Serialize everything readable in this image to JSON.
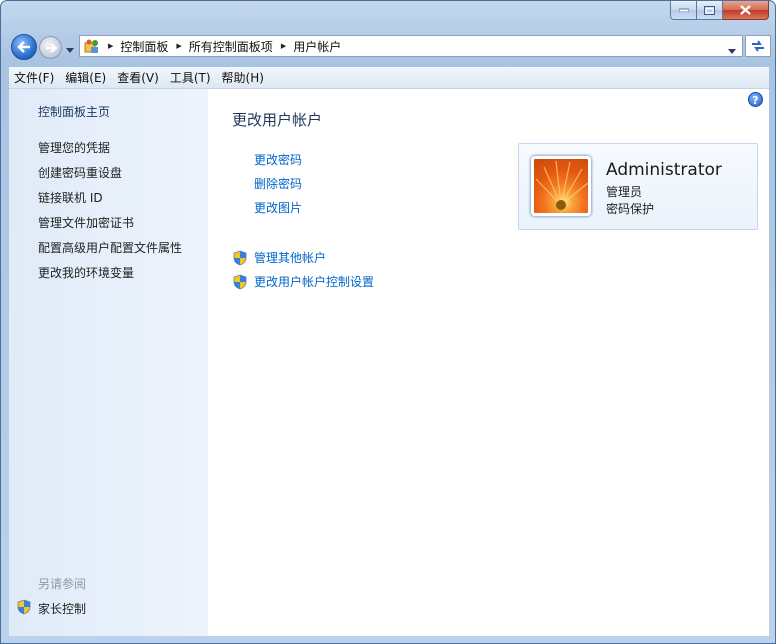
{
  "address_bar": {
    "crumbs": [
      "控制面板",
      "所有控制面板项",
      "用户帐户"
    ]
  },
  "menu": {
    "items": [
      "文件(F)",
      "编辑(E)",
      "查看(V)",
      "工具(T)",
      "帮助(H)"
    ]
  },
  "sidebar": {
    "home_link": "控制面板主页",
    "links": [
      "管理您的凭据",
      "创建密码重设盘",
      "链接联机 ID",
      "管理文件加密证书",
      "配置高级用户配置文件属性",
      "更改我的环境变量"
    ],
    "see_also_label": "另请参阅",
    "see_also_items": [
      "家长控制"
    ]
  },
  "main": {
    "heading": "更改用户帐户",
    "links": [
      "更改密码",
      "删除密码",
      "更改图片"
    ],
    "shield_links": [
      "管理其他帐户",
      "更改用户帐户控制设置"
    ],
    "help_glyph": "?"
  },
  "user_card": {
    "name": "Administrator",
    "role": "管理员",
    "status": "密码保护"
  },
  "colors": {
    "link": "#0066cc",
    "heading": "#1e395b",
    "sidebar_bg": "#e4eef9"
  }
}
